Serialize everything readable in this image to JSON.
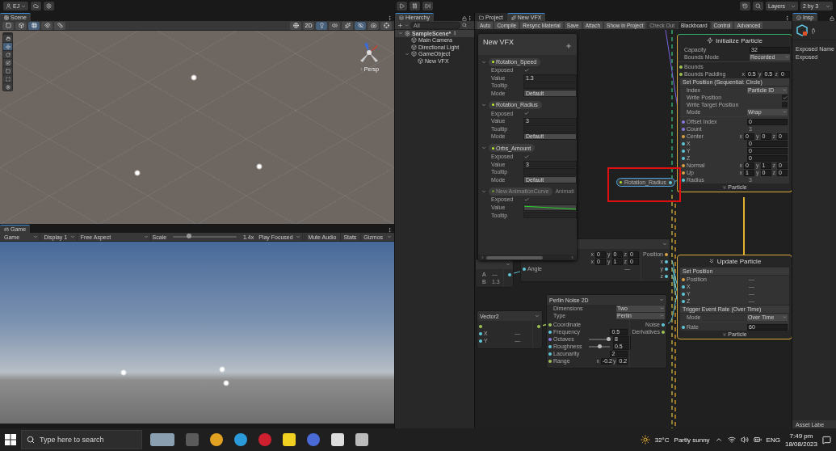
{
  "top_bar": {
    "account": "EJ",
    "layers": "Layers",
    "layout": "2 by 3"
  },
  "scene": {
    "tab": "Scene",
    "view_label": "Persp",
    "left_toggles": [
      {
        "kind": "pivot",
        "selected": false
      },
      {
        "kind": "global",
        "selected": false
      },
      {
        "kind": "grid",
        "selected": true
      },
      {
        "kind": "snap",
        "selected": false
      },
      {
        "kind": "increment",
        "selected": false
      }
    ],
    "toggles": [
      {
        "kind": "shading",
        "selected": false
      },
      {
        "kind": "dimension",
        "label": "2D",
        "selected": false
      },
      {
        "kind": "light",
        "selected": true
      },
      {
        "kind": "audio",
        "selected": false
      },
      {
        "kind": "effects",
        "selected": false
      },
      {
        "kind": "visibility",
        "selected": true
      },
      {
        "kind": "camera",
        "selected": false
      },
      {
        "kind": "gizmo",
        "selected": false
      }
    ],
    "tools": [
      {
        "kind": "hand",
        "selected": false
      },
      {
        "kind": "move",
        "selected": true
      },
      {
        "kind": "rotate",
        "selected": false
      },
      {
        "kind": "scale",
        "selected": false
      },
      {
        "kind": "rect",
        "selected": false
      },
      {
        "kind": "transform",
        "selected": false
      },
      {
        "kind": "custom",
        "selected": false
      }
    ]
  },
  "game": {
    "tab": "Game",
    "mode": "Game",
    "display": "Display 1",
    "aspect": "Free Aspect",
    "scale_label": "Scale",
    "scale": {
      "level": 0.25
    },
    "scale_value": "1.4x",
    "play_mode": "Play Focused",
    "buttons": [
      {
        "label": "Mute Audio",
        "selected": false
      },
      {
        "label": "Stats",
        "selected": false
      },
      {
        "label": "Gizmos",
        "selected": false
      }
    ]
  },
  "hierarchy": {
    "tab": "Hierarchy",
    "search_placeholder": "All",
    "tree": [
      {
        "label": "SampleScene*",
        "kind": "scene",
        "expanded": true,
        "children": [
          {
            "label": "Main Camera",
            "kind": "object"
          },
          {
            "label": "Directional Light",
            "kind": "object"
          },
          {
            "label": "GameObject",
            "kind": "object",
            "expanded": true,
            "children": [
              {
                "label": "New VFX",
                "kind": "object"
              }
            ]
          }
        ]
      }
    ]
  },
  "vfx": {
    "tabs": [
      {
        "label": "Project",
        "kind": "folder",
        "selected": false
      },
      {
        "label": "New VFX",
        "kind": "vfx",
        "selected": true
      }
    ],
    "toolbar": [
      {
        "label": "Auto",
        "selected": false,
        "disabled": false
      },
      {
        "label": "Compile",
        "selected": false,
        "disabled": false
      },
      {
        "label": "Resync Material",
        "selected": false,
        "disabled": false
      },
      {
        "label": "Save",
        "selected": false,
        "disabled": false
      },
      {
        "label": "Attach",
        "selected": false,
        "disabled": false
      },
      {
        "label": "Show in Project",
        "selected": false,
        "disabled": false
      },
      {
        "label": "Check Out",
        "selected": false,
        "disabled": true
      },
      {
        "label": "Blackboard",
        "selected": true,
        "disabled": false
      },
      {
        "label": "Control",
        "selected": false,
        "disabled": false
      },
      {
        "label": "Advanced",
        "selected": false,
        "disabled": false
      }
    ]
  },
  "blackboard": {
    "title": "New VFX",
    "properties": [
      {
        "name": "Rotation_Speed",
        "expanded": true,
        "disabled": false,
        "rows": [
          {
            "label": "Exposed",
            "kind": "check",
            "checked": true
          },
          {
            "label": "Value",
            "kind": "field",
            "value": "1.3"
          },
          {
            "label": "Tooltip",
            "kind": "field"
          },
          {
            "label": "Mode",
            "kind": "select",
            "value": "Default"
          }
        ]
      },
      {
        "name": "Rotation_Radius",
        "expanded": true,
        "disabled": false,
        "rows": [
          {
            "label": "Exposed",
            "kind": "check",
            "checked": true
          },
          {
            "label": "Value",
            "kind": "field",
            "value": "3"
          },
          {
            "label": "Tooltip",
            "kind": "field"
          },
          {
            "label": "Mode",
            "kind": "select",
            "value": "Default"
          }
        ]
      },
      {
        "name": "Orbs_Amount",
        "expanded": true,
        "disabled": false,
        "rows": [
          {
            "label": "Exposed",
            "kind": "check",
            "checked": true
          },
          {
            "label": "Value",
            "kind": "field",
            "value": "3"
          },
          {
            "label": "Tooltip",
            "kind": "field"
          },
          {
            "label": "Mode",
            "kind": "select",
            "value": "Default"
          }
        ]
      },
      {
        "name": "New AnimationCurve",
        "type": "Animati",
        "expanded": true,
        "disabled": true,
        "rows": [
          {
            "label": "Exposed",
            "kind": "check",
            "checked": true
          },
          {
            "label": "Value",
            "kind": "curve"
          },
          {
            "label": "Tooltip",
            "kind": "field"
          }
        ]
      }
    ]
  },
  "graph": {
    "property_node": {
      "label": "Rotation_Radius"
    },
    "contexts": [
      {
        "title": "Initialize Particle",
        "kind": "initialize",
        "footer": "Particle",
        "sections": [
          {
            "rows": [
              {
                "label": "Capacity",
                "kind": "field",
                "value": "32"
              },
              {
                "label": "Bounds Mode",
                "kind": "select",
                "value": "Recorded"
              }
            ],
            "ports": [
              {
                "label": "Bounds",
                "kind": "plain",
                "color": "#9bc25a"
              },
              {
                "label": "Bounds Padding",
                "kind": "vector",
                "color": "#9bc25a",
                "components": [
                  {
                    "axis": "x",
                    "value": "0.5"
                  },
                  {
                    "axis": "y",
                    "value": "0.5"
                  },
                  {
                    "axis": "z",
                    "value": "0"
                  }
                ]
              }
            ]
          },
          {
            "title": "Set Position (Sequential: Circle)",
            "rows": [
              {
                "label": "Index",
                "kind": "select",
                "value": "Particle ID"
              },
              {
                "label": "Write Position",
                "kind": "check",
                "checked": true
              },
              {
                "label": "Write Target Position",
                "kind": "check",
                "checked": false
              },
              {
                "label": "Mode",
                "kind": "select",
                "value": "Wrap"
              }
            ],
            "ports": [
              {
                "label": "Offset Index",
                "kind": "field",
                "value": "0",
                "color": "#8a7ae0"
              },
              {
                "label": "Count",
                "kind": "linked",
                "value": "3",
                "color": "#8a7ae0"
              },
              {
                "label": "Center",
                "kind": "vector",
                "color": "#d9a046",
                "components": [
                  {
                    "axis": "x",
                    "value": "0"
                  },
                  {
                    "axis": "y",
                    "value": "0"
                  },
                  {
                    "axis": "z",
                    "value": "0"
                  }
                ]
              },
              {
                "label": "X",
                "kind": "field",
                "value": "0",
                "color": "#5ec8d8"
              },
              {
                "label": "Y",
                "kind": "field",
                "value": "0",
                "color": "#5ec8d8"
              },
              {
                "label": "Z",
                "kind": "field",
                "value": "0",
                "color": "#5ec8d8"
              },
              {
                "label": "Normal",
                "kind": "vector",
                "color": "#d9a046",
                "components": [
                  {
                    "axis": "x",
                    "value": "0"
                  },
                  {
                    "axis": "y",
                    "value": "1"
                  },
                  {
                    "axis": "z",
                    "value": "0"
                  }
                ]
              },
              {
                "label": "Up",
                "kind": "vector",
                "color": "#d9a046",
                "components": [
                  {
                    "axis": "x",
                    "value": "1"
                  },
                  {
                    "axis": "y",
                    "value": "0"
                  },
                  {
                    "axis": "z",
                    "value": "0"
                  }
                ]
              },
              {
                "label": "Radius",
                "kind": "linked",
                "value": "3",
                "color": "#5ec8d8"
              }
            ]
          }
        ]
      },
      {
        "title": "Update Particle",
        "kind": "update",
        "footer": "Particle",
        "sections": [
          {
            "title": "Set Position",
            "ports": [
              {
                "label": "Position",
                "kind": "linked",
                "value": "—",
                "color": "#d9a046"
              },
              {
                "label": "X",
                "kind": "linked",
                "value": "—",
                "color": "#5ec8d8"
              },
              {
                "label": "Y",
                "kind": "linked",
                "value": "—",
                "color": "#5ec8d8"
              },
              {
                "label": "Z",
                "kind": "linked",
                "value": "—",
                "color": "#5ec8d8"
              }
            ]
          },
          {
            "title": "Trigger Event Rate (Over Time)",
            "rows": [
              {
                "label": "Mode",
                "kind": "select",
                "value": "Over Time"
              }
            ],
            "ports": [
              {
                "label": "Rate",
                "kind": "field",
                "value": "60",
                "color": "#5ec8d8"
              }
            ]
          }
        ]
      }
    ],
    "operators": [
      {
        "inputs": [
          {
            "kind": "vector",
            "components": [
              {
                "axis": "x",
                "value": "0"
              },
              {
                "axis": "y",
                "value": "0"
              },
              {
                "axis": "z",
                "value": "0"
              }
            ]
          },
          {
            "kind": "vector",
            "components": [
              {
                "axis": "x",
                "value": "0"
              },
              {
                "axis": "y",
                "value": "1"
              },
              {
                "axis": "z",
                "value": "0"
              }
            ]
          },
          {
            "label": "Angle",
            "kind": "linked",
            "value": "—",
            "color": "#5ec8d8"
          }
        ],
        "outputs": [
          {
            "label": "Position",
            "color": "#d9a046"
          },
          {
            "label": "x",
            "color": "#5ec8d8"
          },
          {
            "label": "y",
            "color": "#5ec8d8"
          },
          {
            "label": "z",
            "color": "#5ec8d8"
          }
        ]
      },
      {
        "inputs": [
          {
            "label": "A",
            "kind": "linked",
            "value": "—"
          },
          {
            "label": "B",
            "kind": "linked",
            "value": "1.3"
          }
        ],
        "outputs": [
          {
            "color": "#5ec8d8"
          }
        ]
      },
      {
        "title": "Perlin Noise 2D",
        "settings": [
          {
            "label": "Dimensions",
            "kind": "select",
            "value": "Two"
          },
          {
            "label": "Type",
            "kind": "select",
            "value": "Perlin"
          }
        ],
        "inputs": [
          {
            "label": "Coordinate",
            "kind": "plain",
            "color": "#9bc25a"
          },
          {
            "label": "Frequency",
            "kind": "field",
            "value": "0.5",
            "color": "#5ec8d8"
          },
          {
            "label": "Octaves",
            "kind": "slider",
            "level": 0.95,
            "value": "8",
            "color": "#8a7ae0"
          },
          {
            "label": "Roughness",
            "kind": "slider",
            "level": 0.5,
            "value": "0.5",
            "color": "#5ec8d8"
          },
          {
            "label": "Lacunarity",
            "kind": "field",
            "value": "2",
            "color": "#5ec8d8"
          },
          {
            "label": "Range",
            "kind": "vector",
            "color": "#9bc25a",
            "components": [
              {
                "axis": "x",
                "value": "-0.2"
              },
              {
                "axis": "y",
                "value": "0.2"
              }
            ]
          }
        ],
        "outputs": [
          {
            "label": "Noise",
            "color": "#5ec8d8"
          },
          {
            "label": "Derivatives",
            "color": "#9bc25a"
          }
        ]
      },
      {
        "title": "Vector2",
        "inputs": [
          {
            "kind": "plain",
            "color": "#9bc25a"
          },
          {
            "label": "X",
            "kind": "linked",
            "value": "—",
            "color": "#5ec8d8"
          },
          {
            "label": "Y",
            "kind": "linked",
            "value": "—",
            "color": "#5ec8d8"
          }
        ],
        "outputs": [
          {
            "color": "#9bc25a"
          }
        ]
      }
    ]
  },
  "inspector": {
    "tab": "Insp",
    "asset_name": "(\\",
    "labels": [
      "Exposed Name",
      "Exposed"
    ],
    "footer": "Asset Labe"
  },
  "taskbar": {
    "search_placeholder": "Type here to search",
    "temperature": "32°C",
    "weather": "Partly sunny",
    "language": "ENG",
    "time": "7:49 pm",
    "date": "18/08/2023"
  }
}
